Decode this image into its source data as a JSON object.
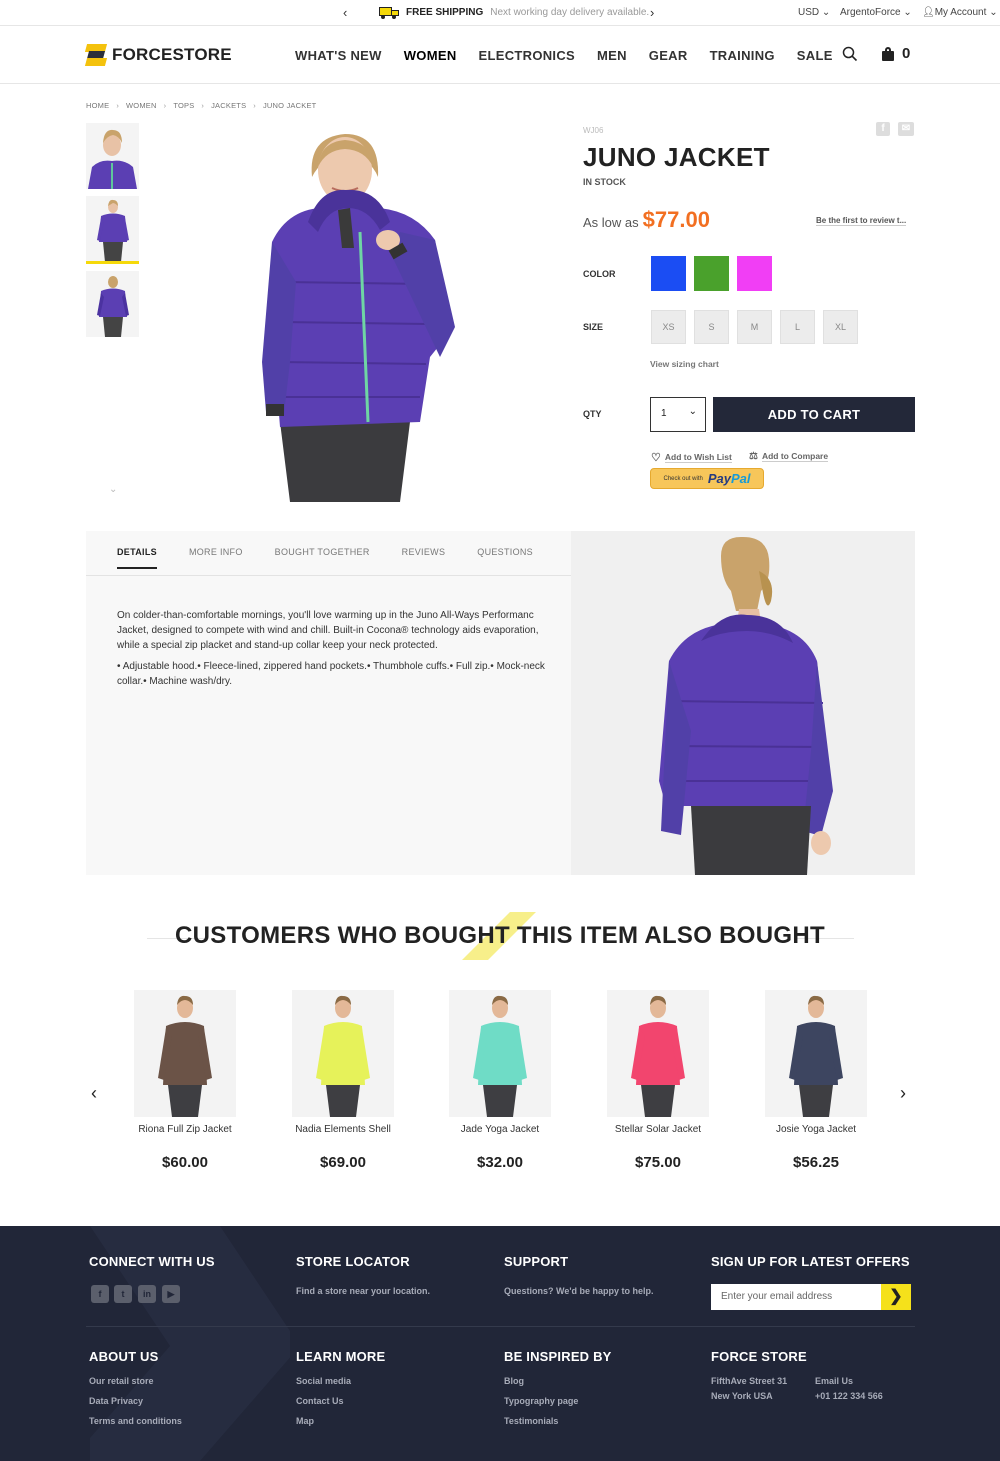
{
  "topbar": {
    "shipping_title": "FREE SHIPPING",
    "shipping_sub": "Next working day delivery available.",
    "currency": "USD",
    "store": "ArgentoForce",
    "account": "My Account"
  },
  "header": {
    "logo": "FORCESTORE",
    "nav": [
      "WHAT'S NEW",
      "WOMEN",
      "ELECTRONICS",
      "MEN",
      "GEAR",
      "TRAINING",
      "SALE"
    ],
    "cart_count": "0"
  },
  "breadcrumb": [
    "HOME",
    "WOMEN",
    "TOPS",
    "JACKETS",
    "JUNO JACKET"
  ],
  "product": {
    "sku": "WJ06",
    "name": "JUNO JACKET",
    "stock": "IN STOCK",
    "price_label": "As low as",
    "price": "$77.00",
    "review_link": "Be the first to review t...",
    "color_label": "COLOR",
    "colors": [
      "#1b4df3",
      "#4aa12c",
      "#f13ef5"
    ],
    "size_label": "SIZE",
    "sizes": [
      "XS",
      "S",
      "M",
      "L",
      "XL"
    ],
    "sizing_chart": "View sizing chart",
    "qty_label": "QTY",
    "qty_value": "1",
    "add_to_cart": "ADD TO CART",
    "wishlist": "Add to Wish List",
    "compare": "Add to Compare",
    "paypal_pre": "Check out with",
    "paypal_brand_a": "Pay",
    "paypal_brand_b": "Pal"
  },
  "tabs": {
    "items": [
      "DETAILS",
      "MORE INFO",
      "BOUGHT TOGETHER",
      "REVIEWS",
      "QUESTIONS"
    ],
    "desc_p1": "On colder-than-comfortable mornings, you'll love warming up in the Juno All-Ways Performanc Jacket, designed to compete with wind and chill. Built-in Cocona® technology aids evaporation, while a special zip placket and stand-up collar keep your neck protected.",
    "desc_p2": "• Adjustable hood.• Fleece-lined, zippered hand pockets.• Thumbhole cuffs.• Full zip.• Mock-neck collar.• Machine wash/dry."
  },
  "related": {
    "title": "CUSTOMERS WHO BOUGHT THIS ITEM ALSO BOUGHT",
    "items": [
      {
        "name": "Riona Full Zip Jacket",
        "price": "$60.00",
        "color": "#6b5347"
      },
      {
        "name": "Nadia Elements Shell",
        "price": "$69.00",
        "color": "#e6f25a"
      },
      {
        "name": "Jade Yoga Jacket",
        "price": "$32.00",
        "color": "#6fdcc6"
      },
      {
        "name": "Stellar Solar Jacket",
        "price": "$75.00",
        "color": "#f2456e"
      },
      {
        "name": "Josie Yoga Jacket",
        "price": "$56.25",
        "color": "#3d4560"
      }
    ]
  },
  "footer": {
    "connect": "CONNECT WITH US",
    "social": [
      "f",
      "t",
      "in",
      "yt"
    ],
    "locator_title": "STORE LOCATOR",
    "locator_text": "Find a store near your location.",
    "support_title": "SUPPORT",
    "support_text": "Questions? We'd be happy to help.",
    "signup_title": "SIGN UP FOR LATEST OFFERS",
    "email_placeholder": "Enter your email address",
    "about_title": "ABOUT US",
    "about_links": [
      "Our retail store",
      "Data Privacy",
      "Terms and conditions"
    ],
    "learn_title": "LEARN MORE",
    "learn_links": [
      "Social media",
      "Contact Us",
      "Map"
    ],
    "inspired_title": "BE INSPIRED BY",
    "inspired_links": [
      "Blog",
      "Typography page",
      "Testimonials"
    ],
    "force_title": "FORCE STORE",
    "address1": "FifthAve Street 31",
    "address2": "New York USA",
    "email_label": "Email Us",
    "phone": "+01 122 334 566"
  },
  "colors": {
    "accent_orange": "#f26f21",
    "accent_yellow": "#f5d90a",
    "dark_navy": "#212638",
    "jacket_purple": "#5b3fb3"
  }
}
